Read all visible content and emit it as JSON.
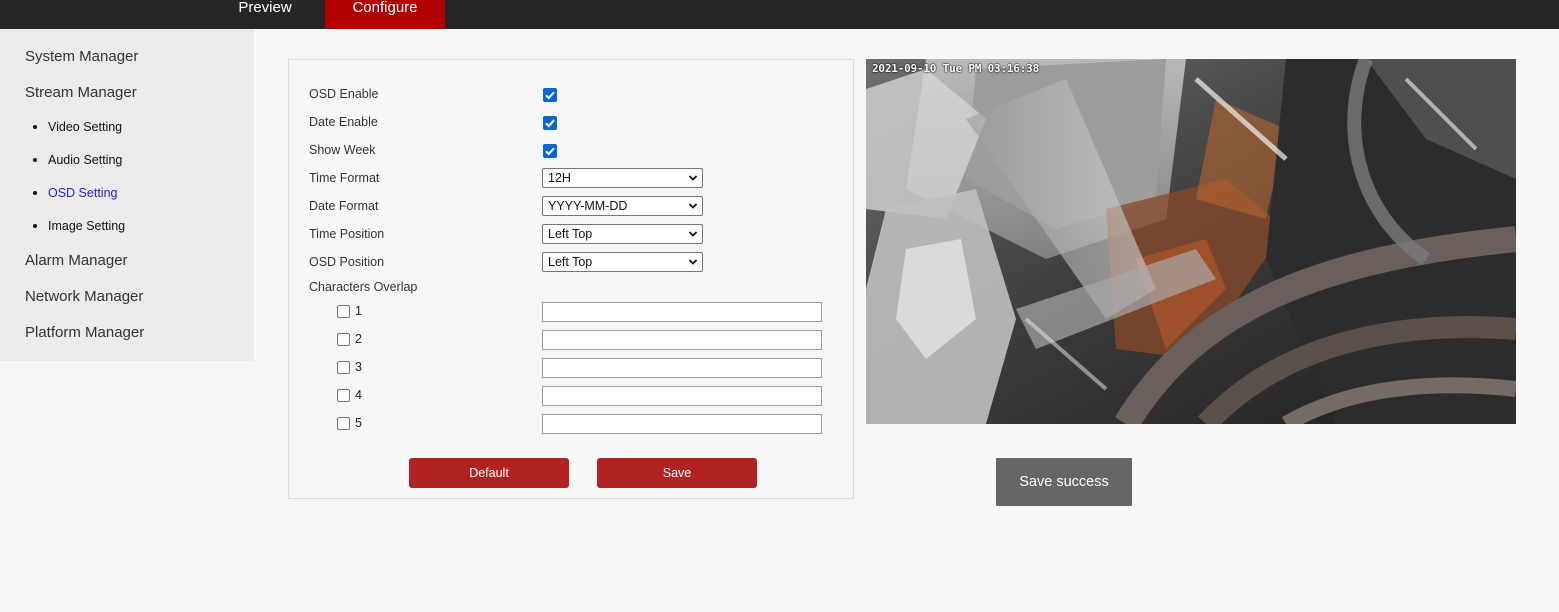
{
  "nav": {
    "tabs": [
      {
        "label": "Preview"
      },
      {
        "label": "Configure"
      }
    ]
  },
  "sidebar": {
    "items": [
      {
        "label": "System Manager"
      },
      {
        "label": "Stream Manager"
      },
      {
        "label": "Alarm Manager"
      },
      {
        "label": "Network Manager"
      },
      {
        "label": "Platform Manager"
      }
    ],
    "sub_items": [
      {
        "label": "Video Setting"
      },
      {
        "label": "Audio Setting"
      },
      {
        "label": "OSD Setting"
      },
      {
        "label": "Image Setting"
      }
    ]
  },
  "form": {
    "osd_enable": {
      "label": "OSD Enable",
      "checked": true
    },
    "date_enable": {
      "label": "Date Enable",
      "checked": true
    },
    "show_week": {
      "label": "Show Week",
      "checked": true
    },
    "time_format": {
      "label": "Time Format",
      "value": "12H"
    },
    "date_format": {
      "label": "Date Format",
      "value": "YYYY-MM-DD"
    },
    "time_position": {
      "label": "Time Position",
      "value": "Left Top"
    },
    "osd_position": {
      "label": "OSD Position",
      "value": "Left Top"
    },
    "characters_overlap": {
      "label": "Characters Overlap",
      "rows": [
        {
          "number": "1",
          "checked": false,
          "value": ""
        },
        {
          "number": "2",
          "checked": false,
          "value": ""
        },
        {
          "number": "3",
          "checked": false,
          "value": ""
        },
        {
          "number": "4",
          "checked": false,
          "value": ""
        },
        {
          "number": "5",
          "checked": false,
          "value": ""
        }
      ]
    },
    "default_label": "Default",
    "save_label": "Save"
  },
  "video": {
    "timestamp": "2021-09-10 Tue PM 03:16:38"
  },
  "toast": {
    "message": "Save success"
  },
  "colors": {
    "accent": "#b00000",
    "button": "#b22222",
    "topbar": "#262626",
    "active_link": "#2222cc",
    "checkbox": "#0a66d6"
  }
}
